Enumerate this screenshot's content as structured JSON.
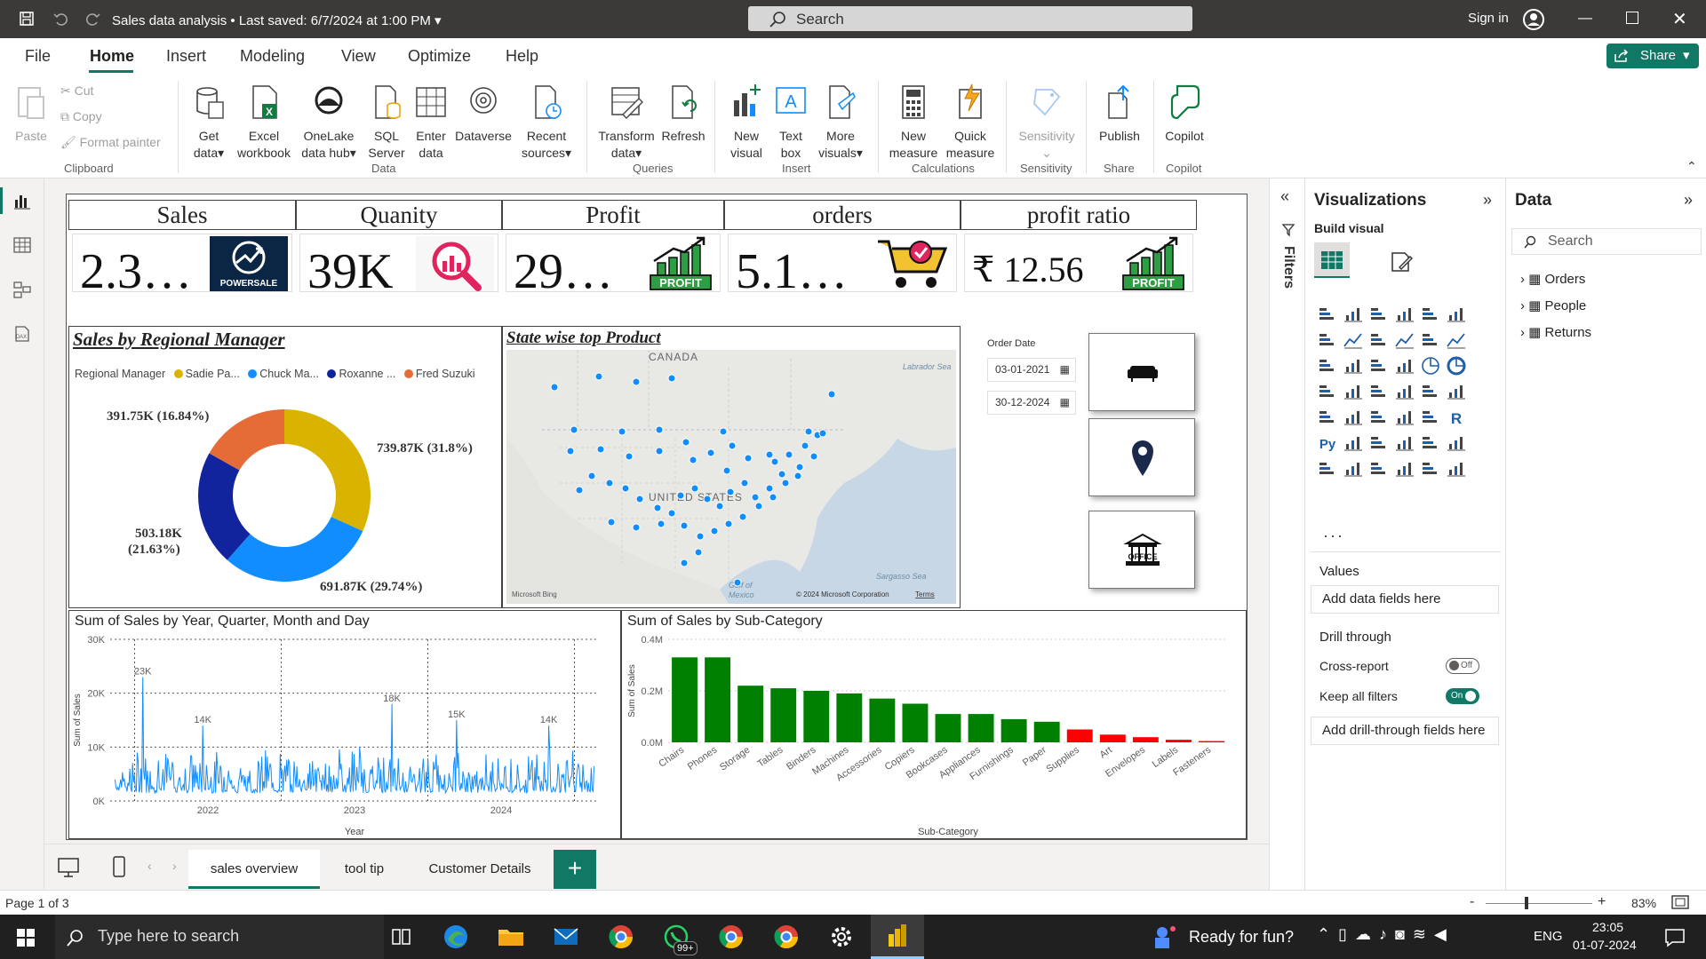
{
  "titlebar": {
    "title": "Sales data analysis",
    "saved": "Last saved: 6/7/2024 at 1:00 PM",
    "search": "Search",
    "signin": "Sign in"
  },
  "menu": {
    "items": [
      "File",
      "Home",
      "Insert",
      "Modeling",
      "View",
      "Optimize",
      "Help"
    ],
    "share": "Share"
  },
  "ribbon": {
    "clipboard": {
      "paste": "Paste",
      "cut": "Cut",
      "copy": "Copy",
      "format": "Format painter",
      "group": "Clipboard"
    },
    "data": {
      "get": [
        "Get",
        "data"
      ],
      "excel": [
        "Excel",
        "workbook"
      ],
      "onelake": [
        "OneLake",
        "data hub"
      ],
      "sql": [
        "SQL",
        "Server"
      ],
      "enter": [
        "Enter",
        "data"
      ],
      "dataverse": "Dataverse",
      "recent": [
        "Recent",
        "sources"
      ],
      "group": "Data"
    },
    "queries": {
      "transform": [
        "Transform",
        "data"
      ],
      "refresh": "Refresh",
      "group": "Queries"
    },
    "insert": {
      "newvisual": [
        "New",
        "visual"
      ],
      "textbox": [
        "Text",
        "box"
      ],
      "more": [
        "More",
        "visuals"
      ],
      "group": "Insert"
    },
    "calc": {
      "newmeasure": [
        "New",
        "measure"
      ],
      "quick": [
        "Quick",
        "measure"
      ],
      "group": "Calculations"
    },
    "sensitivity": {
      "label": "Sensitivity",
      "group": "Sensitivity"
    },
    "share": {
      "publish": "Publish",
      "group": "Share"
    },
    "copilot": {
      "label": "Copilot",
      "group": "Copilot"
    }
  },
  "kpis": [
    {
      "title": "Sales",
      "value": "2.3…",
      "badge": "POWERSALE"
    },
    {
      "title": "Quanity",
      "value": "39K"
    },
    {
      "title": "Profit",
      "value": "29…",
      "badge": "PROFIT"
    },
    {
      "title": "orders",
      "value": "5.1…"
    },
    {
      "title": "profit ratio",
      "value": "₹ 12.56",
      "badge": "PROFIT"
    }
  ],
  "donut": {
    "title": "Sales by Regional Manager",
    "legend_title": "Regional Manager",
    "legend": [
      {
        "name": "Sadie Pa...",
        "color": "#d9b300"
      },
      {
        "name": "Chuck Ma...",
        "color": "#118dff"
      },
      {
        "name": "Roxanne ...",
        "color": "#12239e"
      },
      {
        "name": "Fred Suzuki",
        "color": "#e66c37"
      }
    ],
    "labels": [
      "739.87K (31.8%)",
      "691.87K (29.74%)",
      "503.18K",
      "(21.63%)",
      "391.75K (16.84%)"
    ]
  },
  "map": {
    "title": "State wise top Product",
    "canada": "CANADA",
    "us": "UNITED STATES",
    "labrador": "Labrador Sea",
    "sargasso": "Sargasso Sea",
    "gulf": "Gulf of",
    "mexico": "Mexico",
    "bing": "Microsoft Bing",
    "copyright": "© 2024 Microsoft Corporation",
    "terms": "Terms"
  },
  "slicer": {
    "label": "Order Date",
    "start": "03-01-2021",
    "end": "30-12-2024"
  },
  "cards": {
    "office": "OFFICE"
  },
  "chart_data": [
    {
      "type": "bar",
      "title": "Sum of Sales by Sub-Category",
      "xlabel": "Sub-Category",
      "ylabel": "Sum of Sales",
      "categories": [
        "Chairs",
        "Phones",
        "Storage",
        "Tables",
        "Binders",
        "Machines",
        "Accessories",
        "Copiers",
        "Bookcases",
        "Appliances",
        "Furnishings",
        "Paper",
        "Supplies",
        "Art",
        "Envelopes",
        "Labels",
        "Fasteners"
      ],
      "values": [
        0.33,
        0.33,
        0.22,
        0.21,
        0.2,
        0.19,
        0.17,
        0.15,
        0.11,
        0.11,
        0.09,
        0.08,
        0.05,
        0.03,
        0.02,
        0.01,
        0.005
      ],
      "colors": [
        "#008000",
        "#008000",
        "#008000",
        "#008000",
        "#008000",
        "#008000",
        "#008000",
        "#008000",
        "#008000",
        "#008000",
        "#008000",
        "#008000",
        "#ff0000",
        "#ff0000",
        "#ff0000",
        "#ff0000",
        "#ff0000"
      ],
      "ylim": [
        0,
        0.4
      ],
      "ytick_labels": [
        "0.0M",
        "0.2M",
        "0.4M"
      ]
    },
    {
      "type": "line",
      "title": "Sum of Sales by Year, Quarter, Month and Day",
      "xlabel": "Year",
      "ylabel": "Sum of Sales",
      "xticks": [
        "2022",
        "2023",
        "2024"
      ],
      "ytick_labels": [
        "0K",
        "10K",
        "20K",
        "30K"
      ],
      "ylim": [
        0,
        30000
      ],
      "peaks": [
        {
          "label": "23K",
          "value": 23000
        },
        {
          "label": "14K",
          "value": 14000
        },
        {
          "label": "18K",
          "value": 18000
        },
        {
          "label": "15K",
          "value": 15000
        },
        {
          "label": "14K",
          "value": 14000
        }
      ],
      "color": "#118dff"
    }
  ],
  "filters": {
    "label": "Filters"
  },
  "viz": {
    "title": "Visualizations",
    "build": "Build visual",
    "values": "Values",
    "add_fields": "Add data fields here",
    "drill": "Drill through",
    "cross": "Cross-report",
    "cross_state": "Off",
    "keep": "Keep all filters",
    "keep_state": "On",
    "add_drill": "Add drill-through fields here",
    "py": "Py",
    "r": "R",
    "more": "···"
  },
  "data": {
    "title": "Data",
    "search": "Search",
    "tables": [
      "Orders",
      "People",
      "Returns"
    ]
  },
  "pages": {
    "tabs": [
      "sales overview",
      "tool tip",
      "Customer Details"
    ],
    "add": "+"
  },
  "status": {
    "page": "Page 1 of 3",
    "zoom": "83%",
    "minus": "-",
    "plus": "+"
  },
  "taskbar": {
    "search": "Type here to search",
    "ready": "Ready for fun?",
    "lang": "ENG",
    "time": "23:05",
    "date": "01-07-2024",
    "badge": "99+"
  }
}
